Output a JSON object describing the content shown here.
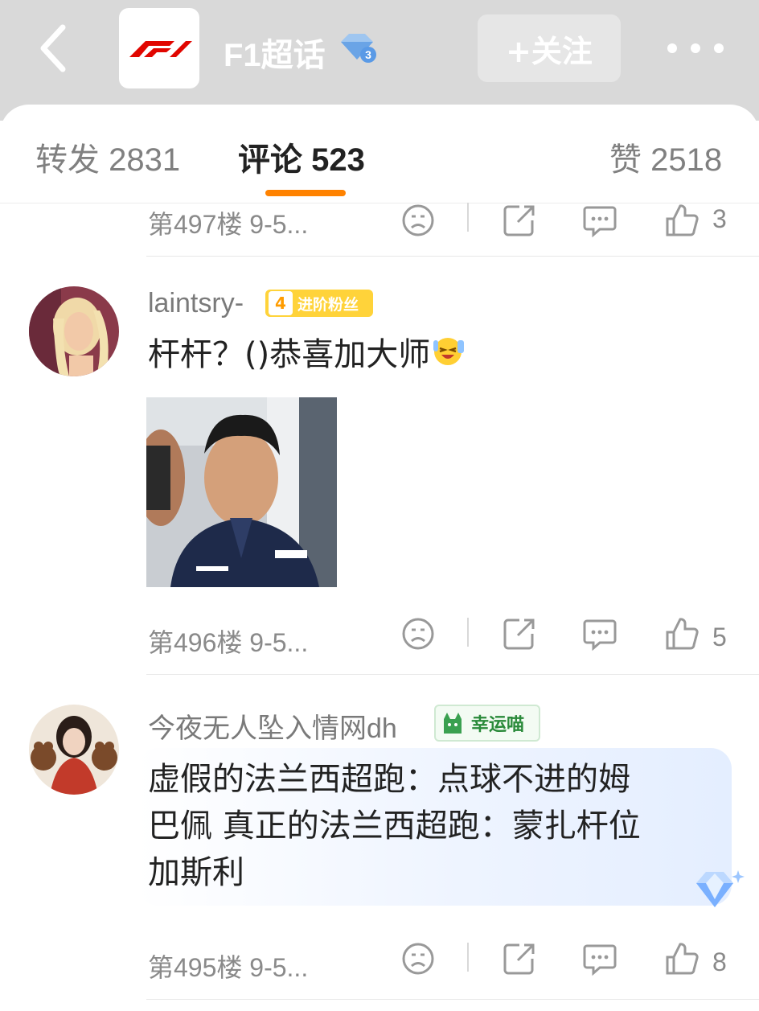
{
  "header": {
    "title": "F1超话",
    "follow_label": "+关注",
    "super_level": "3"
  },
  "tabs": {
    "repost": "转发 2831",
    "comment": "评论 523",
    "like": "赞 2518"
  },
  "comments": [
    {
      "floor": "第497楼 9-5...",
      "likes": "3"
    },
    {
      "user": "laintsry-",
      "badge_level": "4",
      "badge_text": "进阶粉丝",
      "text": "杆杆？()恭喜加大师",
      "floor": "第496楼 9-5...",
      "likes": "5"
    },
    {
      "user": "今夜无人坠入情网dh",
      "badge_text": "幸运喵",
      "text_lines": [
        "虚假的法兰西超跑：点球不进的姆",
        "巴佩 真正的法兰西超跑：蒙扎杆位",
        "加斯利"
      ],
      "floor": "第495楼 9-5...",
      "likes": "8"
    }
  ],
  "colors": {
    "accent": "#ff8200",
    "header_bg": "#d9d9d9",
    "f1_red": "#e10600",
    "fan_badge": "#ffd33a"
  },
  "icons": [
    "back-icon",
    "f1-logo",
    "diamond-level-icon",
    "more-icon",
    "dislike-icon",
    "repost-icon",
    "comment-icon",
    "like-icon",
    "smiley-emoji",
    "cat-icon",
    "diamond-decoration-icon"
  ]
}
